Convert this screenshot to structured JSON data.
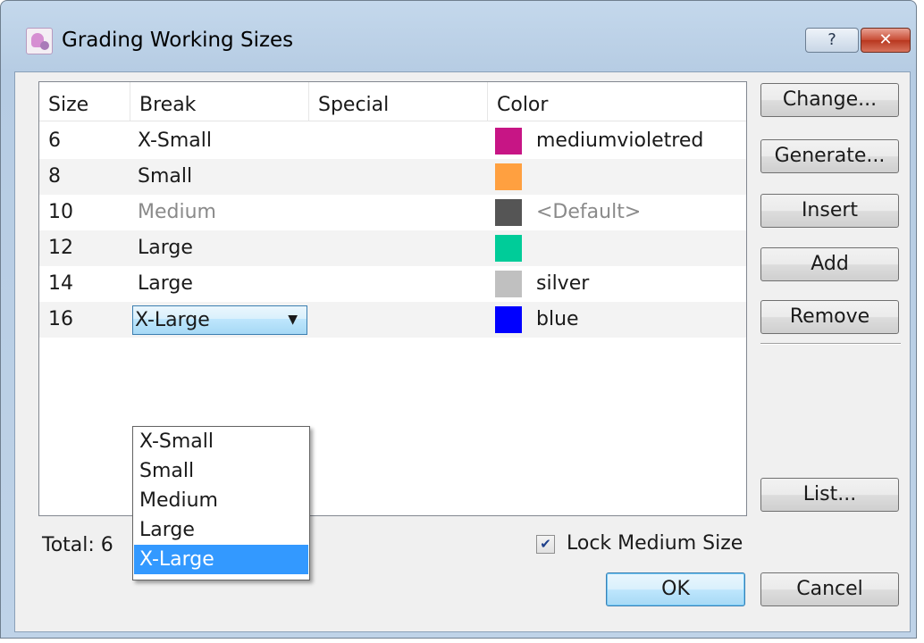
{
  "window": {
    "title": "Grading Working Sizes",
    "help_label": "?",
    "close_label": "✕"
  },
  "table": {
    "columns": [
      "Size",
      "Break",
      "Special",
      "Color"
    ],
    "rows": [
      {
        "size": "6",
        "break": "X-Small",
        "special": "",
        "color_name": "mediumvioletred",
        "swatch": "#c71585",
        "muted": false
      },
      {
        "size": "8",
        "break": "Small",
        "special": "",
        "color_name": "",
        "swatch": "#ffa040",
        "muted": false
      },
      {
        "size": "10",
        "break": "Medium",
        "special": "",
        "color_name": "<Default>",
        "swatch": "#555555",
        "muted": true
      },
      {
        "size": "12",
        "break": "Large",
        "special": "",
        "color_name": "",
        "swatch": "#00cc99",
        "muted": false
      },
      {
        "size": "14",
        "break": "Large",
        "special": "",
        "color_name": "silver",
        "swatch": "#c0c0c0",
        "muted": false
      },
      {
        "size": "16",
        "break": "X-Large",
        "special": "",
        "color_name": "blue",
        "swatch": "#0000ff",
        "muted": false
      }
    ]
  },
  "break_dropdown": {
    "selected": "X-Large",
    "arrow": "▼",
    "options": [
      "X-Small",
      "Small",
      "Medium",
      "Large",
      "X-Large"
    ]
  },
  "side_buttons": {
    "change": "Change...",
    "generate": "Generate...",
    "insert": "Insert",
    "add": "Add",
    "remove": "Remove",
    "list": "List..."
  },
  "footer": {
    "total_label": "Total:  6",
    "lock_label": "Lock Medium Size",
    "lock_checked": true,
    "check_mark": "✔",
    "ok_label": "OK",
    "cancel_label": "Cancel"
  }
}
